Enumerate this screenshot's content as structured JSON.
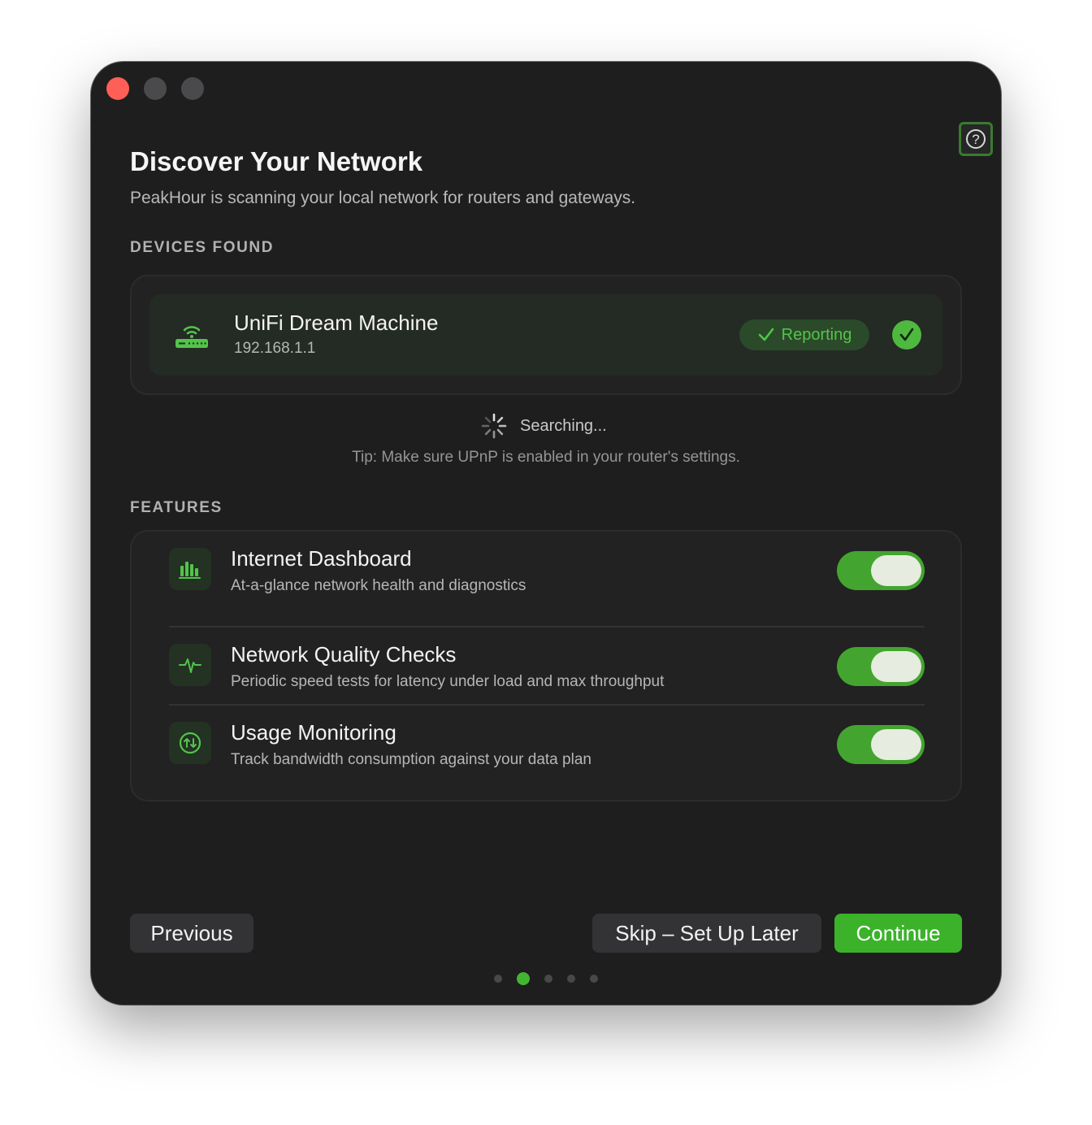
{
  "window": {
    "title": "Discover Your Network",
    "subtitle": "PeakHour is scanning your local network for routers and gateways."
  },
  "help": {
    "icon": "question-icon",
    "glyph": "?"
  },
  "devices": {
    "section_label": "DEVICES FOUND",
    "items": [
      {
        "name": "UniFi Dream Machine",
        "ip": "192.168.1.1",
        "status": "Reporting",
        "icon": "router-icon"
      }
    ]
  },
  "search": {
    "status": "Searching...",
    "tip": "Tip: Make sure UPnP is enabled in your router's settings."
  },
  "features": {
    "section_label": "FEATURES",
    "items": [
      {
        "title": "Internet Dashboard",
        "description": "At-a-glance network health and diagnostics",
        "icon": "bar-chart-icon",
        "enabled": true
      },
      {
        "title": "Network Quality Checks",
        "description": "Periodic speed tests for latency under load and max throughput",
        "icon": "waveform-icon",
        "enabled": true
      },
      {
        "title": "Usage Monitoring",
        "description": "Track bandwidth consumption against your data plan",
        "icon": "transfer-arrows-icon",
        "enabled": true
      }
    ]
  },
  "footer": {
    "previous": "Previous",
    "skip": "Skip – Set Up Later",
    "continue": "Continue"
  },
  "pager": {
    "total": 5,
    "current": 2
  },
  "colors": {
    "accent": "#43b530",
    "close": "#ff5f57",
    "background": "#1e1e1f"
  }
}
